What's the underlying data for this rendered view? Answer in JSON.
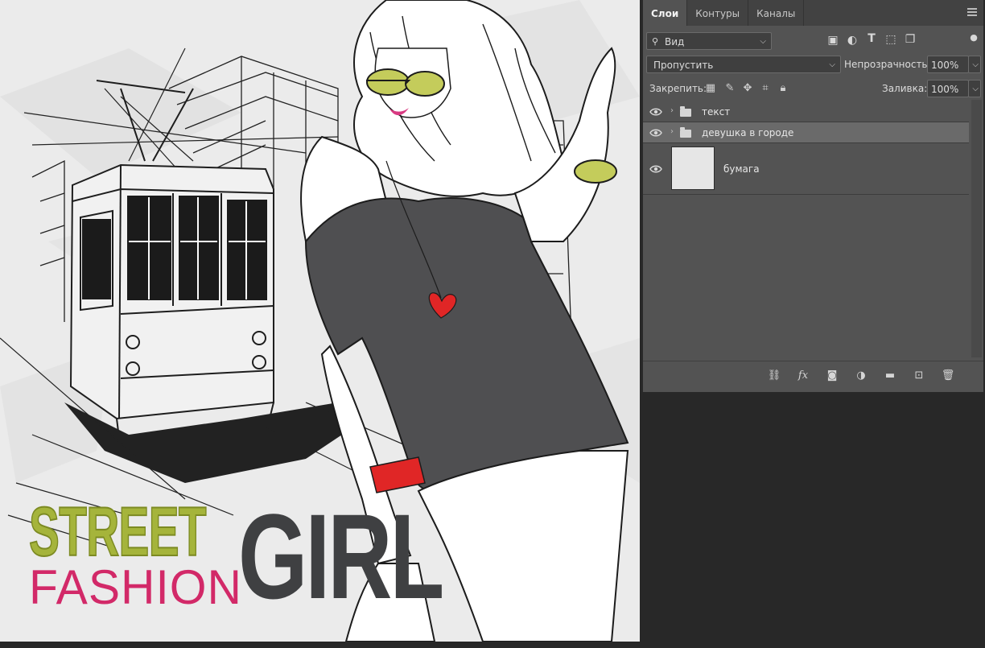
{
  "artwork": {
    "title_street": "STREET",
    "title_fashion": "FASHION",
    "title_girl": "GIRL"
  },
  "panel": {
    "tabs": [
      {
        "label": "Слои",
        "active": true
      },
      {
        "label": "Контуры",
        "active": false
      },
      {
        "label": "Каналы",
        "active": false
      }
    ],
    "filter": {
      "label": "Вид",
      "icon": "search-icon"
    },
    "blend_mode": "Пропустить",
    "opacity_label": "Непрозрачность:",
    "opacity_value": "100%",
    "lock_label": "Закрепить:",
    "fill_label": "Заливка:",
    "fill_value": "100%",
    "layers": [
      {
        "name": "текст",
        "type": "group",
        "visible": true,
        "selected": false
      },
      {
        "name": "девушка в городе",
        "type": "group",
        "visible": true,
        "selected": true
      },
      {
        "name": "бумага",
        "type": "pixel",
        "visible": true,
        "selected": false
      }
    ],
    "footer_icons": [
      "link-icon",
      "fx-icon",
      "mask-icon",
      "adjustment-icon",
      "folder-icon",
      "new-layer-icon",
      "trash-icon"
    ]
  },
  "colors": {
    "street": "#a5b43b",
    "fashion": "#d22968",
    "girl": "#3f4042",
    "shirt": "#4f4f51",
    "glasses": "#c4cc5b",
    "heart": "#e02626"
  }
}
